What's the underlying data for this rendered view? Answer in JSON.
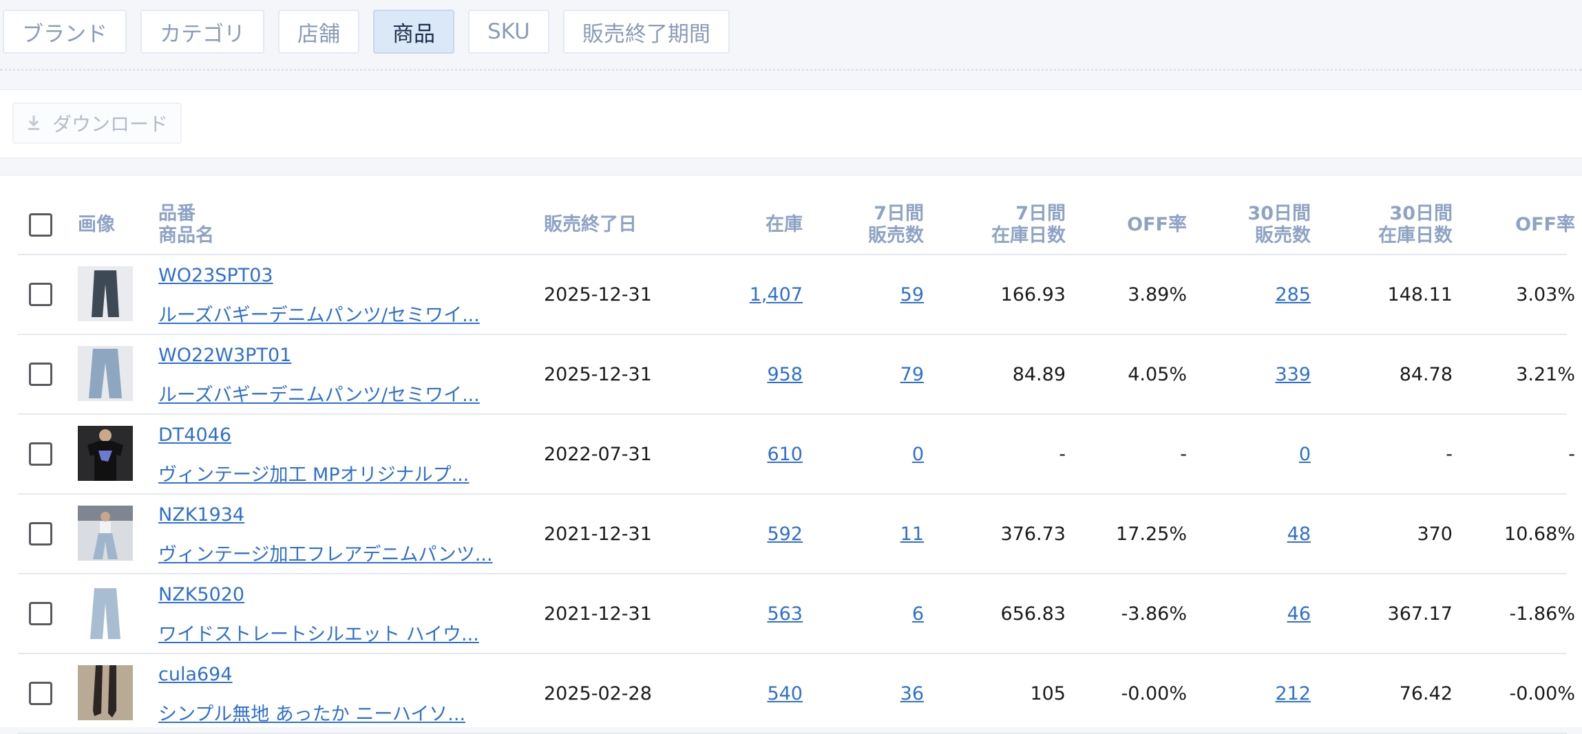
{
  "tabs": [
    {
      "label": "ブランド",
      "active": false
    },
    {
      "label": "カテゴリ",
      "active": false
    },
    {
      "label": "店舗",
      "active": false
    },
    {
      "label": "商品",
      "active": true
    },
    {
      "label": "SKU",
      "active": false
    },
    {
      "label": "販売終了期間",
      "active": false
    }
  ],
  "toolbar": {
    "download_label": "ダウンロード",
    "download_icon": "download-icon"
  },
  "table": {
    "headers": {
      "image": "画像",
      "code": "品番",
      "name": "商品名",
      "end_date": "販売終了日",
      "stock": "在庫",
      "sales7_l1": "7日間",
      "sales7_l2": "販売数",
      "days7_l1": "7日間",
      "days7_l2": "在庫日数",
      "off7": "OFF率",
      "sales30_l1": "30日間",
      "sales30_l2": "販売数",
      "days30_l1": "30日間",
      "days30_l2": "在庫日数",
      "off30": "OFF率"
    },
    "rows": [
      {
        "code": "WO23SPT03",
        "name": "ルーズバギーデニムパンツ/セミワイ...",
        "end_date": "2025-12-31",
        "stock": "1,407",
        "sales7": "59",
        "days7": "166.93",
        "off7": "3.89%",
        "sales30": "285",
        "days30": "148.11",
        "off30": "3.03%",
        "thumb": "dark-denim-pants"
      },
      {
        "code": "WO22W3PT01",
        "name": "ルーズバギーデニムパンツ/セミワイ...",
        "end_date": "2025-12-31",
        "stock": "958",
        "sales7": "79",
        "days7": "84.89",
        "off7": "4.05%",
        "sales30": "339",
        "days30": "84.78",
        "off30": "3.21%",
        "thumb": "light-denim-pants"
      },
      {
        "code": "DT4046",
        "name": "ヴィンテージ加工 MPオリジナルプ...",
        "end_date": "2022-07-31",
        "stock": "610",
        "sales7": "0",
        "days7": "-",
        "off7": "-",
        "sales30": "0",
        "days30": "-",
        "off30": "-",
        "thumb": "black-tshirt"
      },
      {
        "code": "NZK1934",
        "name": "ヴィンテージ加工フレアデニムパンツ...",
        "end_date": "2021-12-31",
        "stock": "592",
        "sales7": "11",
        "days7": "376.73",
        "off7": "17.25%",
        "sales30": "48",
        "days30": "370",
        "off30": "10.68%",
        "thumb": "flare-denim-model"
      },
      {
        "code": "NZK5020",
        "name": "ワイドストレートシルエット ハイウ...",
        "end_date": "2021-12-31",
        "stock": "563",
        "sales7": "6",
        "days7": "656.83",
        "off7": "-3.86%",
        "sales30": "46",
        "days30": "367.17",
        "off30": "-1.86%",
        "thumb": "wide-denim-pants"
      },
      {
        "code": "cula694",
        "name": "シンプル無地 あったか ニーハイソ...",
        "end_date": "2025-02-28",
        "stock": "540",
        "sales7": "36",
        "days7": "105",
        "off7": "-0.00%",
        "sales30": "212",
        "days30": "76.42",
        "off30": "-0.00%",
        "thumb": "knee-high-socks"
      }
    ]
  },
  "colors": {
    "link": "#2f6fd1",
    "header_text": "#8ea3c4",
    "active_tab_bg": "#dbe8f8"
  }
}
